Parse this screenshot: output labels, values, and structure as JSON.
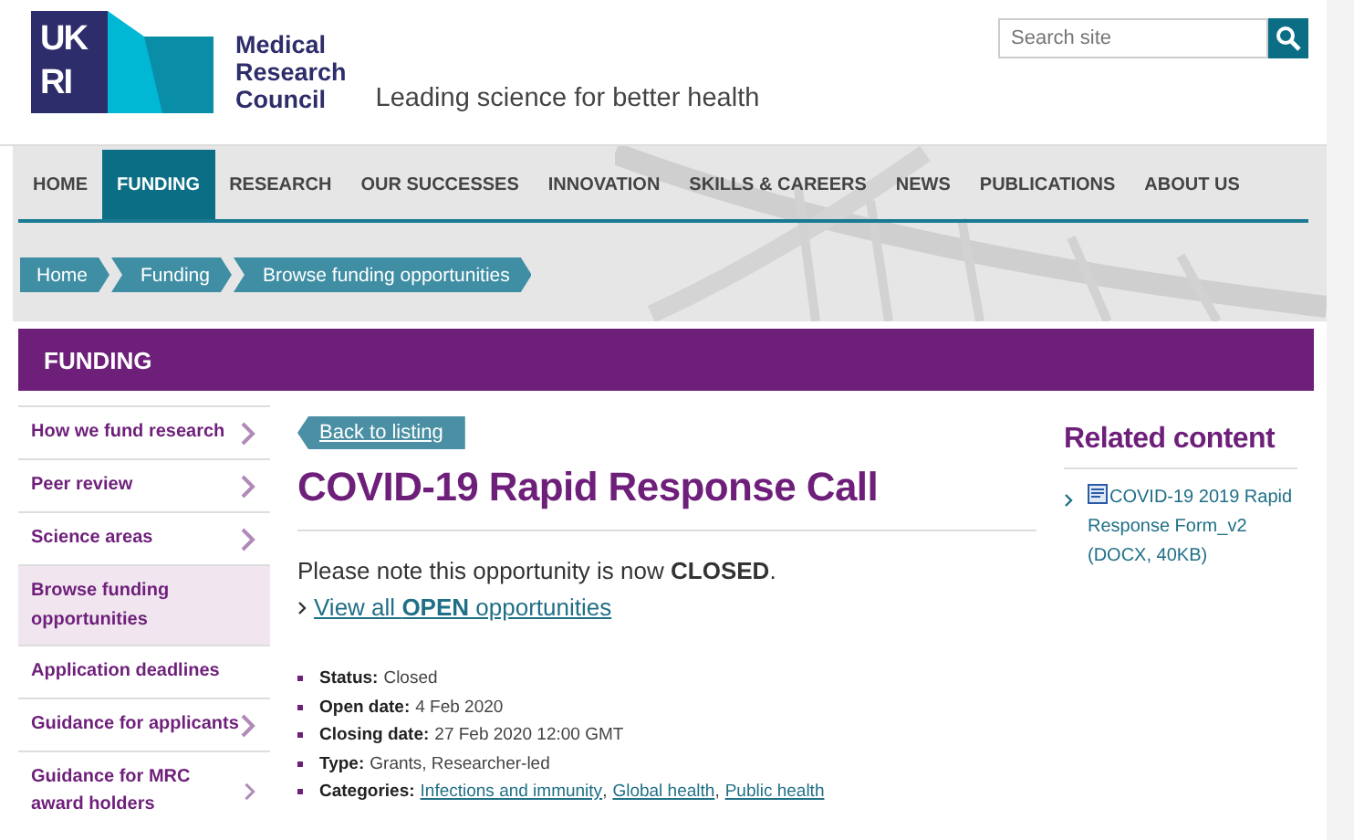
{
  "header": {
    "logo_text": [
      "UK",
      "RI"
    ],
    "org_name": [
      "Medical",
      "Research",
      "Council"
    ],
    "tagline": "Leading science for better health",
    "search": {
      "placeholder": "Search site"
    }
  },
  "nav": [
    {
      "label": "HOME",
      "selected": false
    },
    {
      "label": "FUNDING",
      "selected": true
    },
    {
      "label": "RESEARCH",
      "selected": false
    },
    {
      "label": "OUR SUCCESSES",
      "selected": false
    },
    {
      "label": "INNOVATION",
      "selected": false
    },
    {
      "label": "SKILLS & CAREERS",
      "selected": false
    },
    {
      "label": "NEWS",
      "selected": false
    },
    {
      "label": "PUBLICATIONS",
      "selected": false
    },
    {
      "label": "ABOUT US",
      "selected": false
    }
  ],
  "breadcrumb": [
    "Home",
    "Funding",
    "Browse funding opportunities"
  ],
  "section_title": "FUNDING",
  "sidebar": [
    {
      "label": "How we fund research",
      "selected": false,
      "has_children": true
    },
    {
      "label": "Peer review",
      "selected": false,
      "has_children": true
    },
    {
      "label": "Science areas",
      "selected": false,
      "has_children": true
    },
    {
      "label": "Browse funding opportunities",
      "selected": true,
      "has_children": false
    },
    {
      "label": "Application deadlines",
      "selected": false,
      "has_children": false
    },
    {
      "label": "Guidance for applicants",
      "selected": false,
      "has_children": true
    },
    {
      "label": "Guidance for MRC award holders",
      "selected": false,
      "has_children": true
    }
  ],
  "main": {
    "back_link": "Back to listing",
    "title": "COVID-19 Rapid Response Call",
    "notice": "Please note this opportunity is now **CLOSED**.",
    "open_link": "View all **OPEN** opportunities",
    "details": [
      {
        "label": "Status:",
        "value": "Closed"
      },
      {
        "label": "Open date:",
        "value": "4 Feb 2020"
      },
      {
        "label": "Closing date:",
        "value": "27 Feb 2020 12:00 GMT"
      },
      {
        "label": "Type:",
        "value": "Grants, Researcher-led"
      },
      {
        "label": "Categories:",
        "separator": ",",
        "links": [
          "Infections and immunity",
          "Global health",
          "Public health"
        ]
      }
    ]
  },
  "related": {
    "title": "Related content",
    "items": [
      {
        "label": "COVID-19 2019 Rapid Response Form_v2",
        "meta": "(DOCX, 40KB)"
      }
    ]
  }
}
